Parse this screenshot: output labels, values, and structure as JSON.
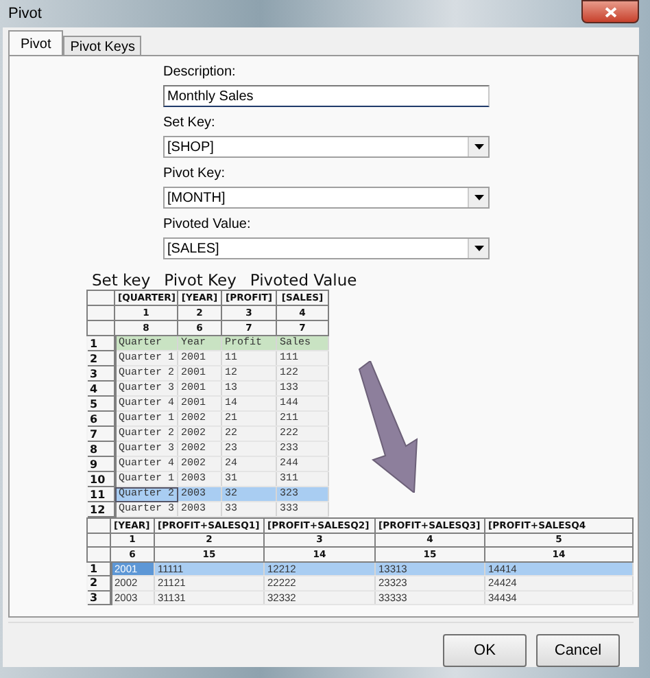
{
  "window": {
    "title": "Pivot"
  },
  "tabs": [
    {
      "label": "Pivot",
      "selected": true
    },
    {
      "label": "Pivot Keys",
      "selected": false
    }
  ],
  "form": [
    {
      "label": "Description:",
      "value": "Monthly Sales",
      "kind": "text"
    },
    {
      "label": "Set Key:",
      "value": "[SHOP]",
      "kind": "dropdown"
    },
    {
      "label": "Pivot Key:",
      "value": "[MONTH]",
      "kind": "dropdown"
    },
    {
      "label": "Pivoted Value:",
      "value": "[SALES]",
      "kind": "dropdown"
    }
  ],
  "illustration": {
    "captions": [
      "Set key",
      "Pivot Key",
      "Pivoted Value"
    ],
    "source_grid": {
      "header_rows": [
        [
          "[QUARTER]",
          "[YEAR]",
          "[PROFIT]",
          "[SALES]"
        ],
        [
          "1",
          "2",
          "3",
          "4"
        ],
        [
          "8",
          "6",
          "7",
          "7"
        ]
      ],
      "rows": [
        {
          "number": "1",
          "kind": "title",
          "selected": false,
          "cells": [
            "Quarter",
            "Year",
            "Profit",
            "Sales"
          ]
        },
        {
          "number": "2",
          "kind": "data",
          "selected": false,
          "cells": [
            "Quarter 1",
            "2001",
            "11",
            "111"
          ]
        },
        {
          "number": "3",
          "kind": "data",
          "selected": false,
          "cells": [
            "Quarter 2",
            "2001",
            "12",
            "122"
          ]
        },
        {
          "number": "4",
          "kind": "data",
          "selected": false,
          "cells": [
            "Quarter 3",
            "2001",
            "13",
            "133"
          ]
        },
        {
          "number": "5",
          "kind": "data",
          "selected": false,
          "cells": [
            "Quarter 4",
            "2001",
            "14",
            "144"
          ]
        },
        {
          "number": "6",
          "kind": "data",
          "selected": false,
          "cells": [
            "Quarter 1",
            "2002",
            "21",
            "211"
          ]
        },
        {
          "number": "7",
          "kind": "data",
          "selected": false,
          "cells": [
            "Quarter 2",
            "2002",
            "22",
            "222"
          ]
        },
        {
          "number": "8",
          "kind": "data",
          "selected": false,
          "cells": [
            "Quarter 3",
            "2002",
            "23",
            "233"
          ]
        },
        {
          "number": "9",
          "kind": "data",
          "selected": false,
          "cells": [
            "Quarter 4",
            "2002",
            "24",
            "244"
          ]
        },
        {
          "number": "10",
          "kind": "data",
          "selected": false,
          "cells": [
            "Quarter 1",
            "2003",
            "31",
            "311"
          ]
        },
        {
          "number": "11",
          "kind": "data",
          "selected": true,
          "cells": [
            "Quarter 2",
            "2003",
            "32",
            "323"
          ]
        },
        {
          "number": "12",
          "kind": "data",
          "selected": false,
          "cells": [
            "Quarter 3",
            "2003",
            "33",
            "333"
          ]
        }
      ]
    },
    "result_grid": {
      "header_rows": [
        [
          "[YEAR]",
          "[PROFIT+SALESQ1]",
          "[PROFIT+SALESQ2]",
          "[PROFIT+SALESQ3]",
          "[PROFIT+SALESQ4"
        ],
        [
          "1",
          "2",
          "3",
          "4",
          "5"
        ],
        [
          "6",
          "15",
          "14",
          "15",
          "14"
        ]
      ],
      "rows": [
        {
          "number": "1",
          "kind": "data",
          "selected": true,
          "cells": [
            "2001",
            "11111",
            "12212",
            "13313",
            "14414"
          ]
        },
        {
          "number": "2",
          "kind": "data",
          "selected": false,
          "cells": [
            "2002",
            "21121",
            "22222",
            "23323",
            "24424"
          ]
        },
        {
          "number": "3",
          "kind": "data",
          "selected": false,
          "cells": [
            "2003",
            "31131",
            "32332",
            "33333",
            "34434"
          ]
        }
      ]
    }
  },
  "buttons": [
    "OK",
    "Cancel"
  ]
}
